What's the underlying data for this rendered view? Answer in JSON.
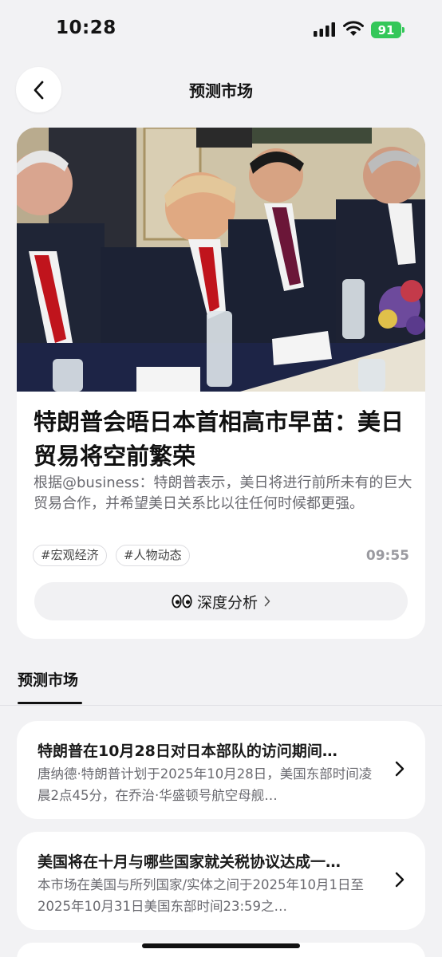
{
  "status_bar": {
    "time": "10:28",
    "battery": "91",
    "battery_color": "#34c759"
  },
  "nav": {
    "title": "预测市场",
    "back_icon": "chevron-left-icon"
  },
  "news": {
    "image_subject": "meeting-photo",
    "headline": "特朗普会晤日本首相高市早苗：美日贸易将空前繁荣",
    "summary": "根据@business：特朗普表示，美日将进行前所未有的巨大贸易合作，并希望美日关系比以往任何时候都更强。",
    "tags": [
      "#宏观经济",
      "#人物动态"
    ],
    "time": "09:55",
    "analysis_label": "深度分析",
    "analysis_icon": "eyes-icon"
  },
  "section": {
    "tab_label": "预测市场"
  },
  "markets": [
    {
      "title": "特朗普在10月28日对日本部队的访问期间…",
      "description": "唐纳德·特朗普计划于2025年10月28日，美国东部时间凌晨2点45分，在乔治·华盛顿号航空母舰…"
    },
    {
      "title": "美国将在十月与哪些国家就关税协议达成一…",
      "description": "本市场在美国与所列国家/实体之间于2025年10月1日至2025年10月31日美国东部时间23:59之…"
    }
  ]
}
